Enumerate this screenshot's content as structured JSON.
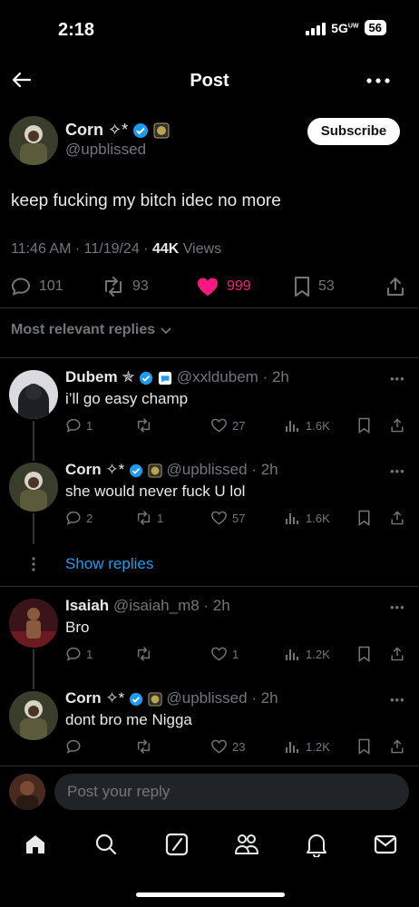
{
  "status_bar": {
    "time": "2:18",
    "network": "5G",
    "network_suffix": "UW",
    "battery": "56"
  },
  "nav": {
    "title": "Post"
  },
  "post": {
    "author_name": "Corn",
    "author_emoji": "✧*",
    "author_handle": "@upblissed",
    "subscribe_label": "Subscribe",
    "text": "keep fucking my bitch idec no more",
    "timestamp": "11:46 AM · 11/19/24 · ",
    "views_count": "44K",
    "views_label": " Views",
    "replies": "101",
    "reposts": "93",
    "likes": "999",
    "bookmarks": "53"
  },
  "sort_label": "Most relevant replies",
  "replies": [
    {
      "name": "Dubem",
      "name_emoji": "✯",
      "handle": "@xxldubem",
      "time": "· 2h",
      "text": "i’ll go easy champ",
      "replies": "1",
      "reposts": "",
      "likes": "27",
      "views": "1.6K"
    },
    {
      "name": "Corn",
      "name_emoji": "✧*",
      "handle": "@upblissed",
      "time": "· 2h",
      "text": "she would never fuck U lol",
      "replies": "2",
      "reposts": "1",
      "likes": "57",
      "views": "1.6K"
    },
    {
      "name": "Isaiah",
      "name_emoji": "",
      "handle": "@isaiah_m8",
      "time": "· 2h",
      "text": "Bro",
      "replies": "1",
      "reposts": "",
      "likes": "1",
      "views": "1.2K"
    },
    {
      "name": "Corn",
      "name_emoji": "✧*",
      "handle": "@upblissed",
      "time": "· 2h",
      "text": "dont bro me Nigga",
      "replies": "",
      "reposts": "",
      "likes": "23",
      "views": "1.2K"
    }
  ],
  "show_replies_label": "Show replies",
  "compose": {
    "placeholder": "Post your reply"
  },
  "tabbar": {
    "items": [
      "home-icon",
      "search-icon",
      "grok-icon",
      "communities-icon",
      "notifications-icon",
      "messages-icon"
    ]
  },
  "colors": {
    "accent": "#1d9bf0",
    "like": "#f91880",
    "background": "#000000",
    "muted": "#71767b"
  }
}
